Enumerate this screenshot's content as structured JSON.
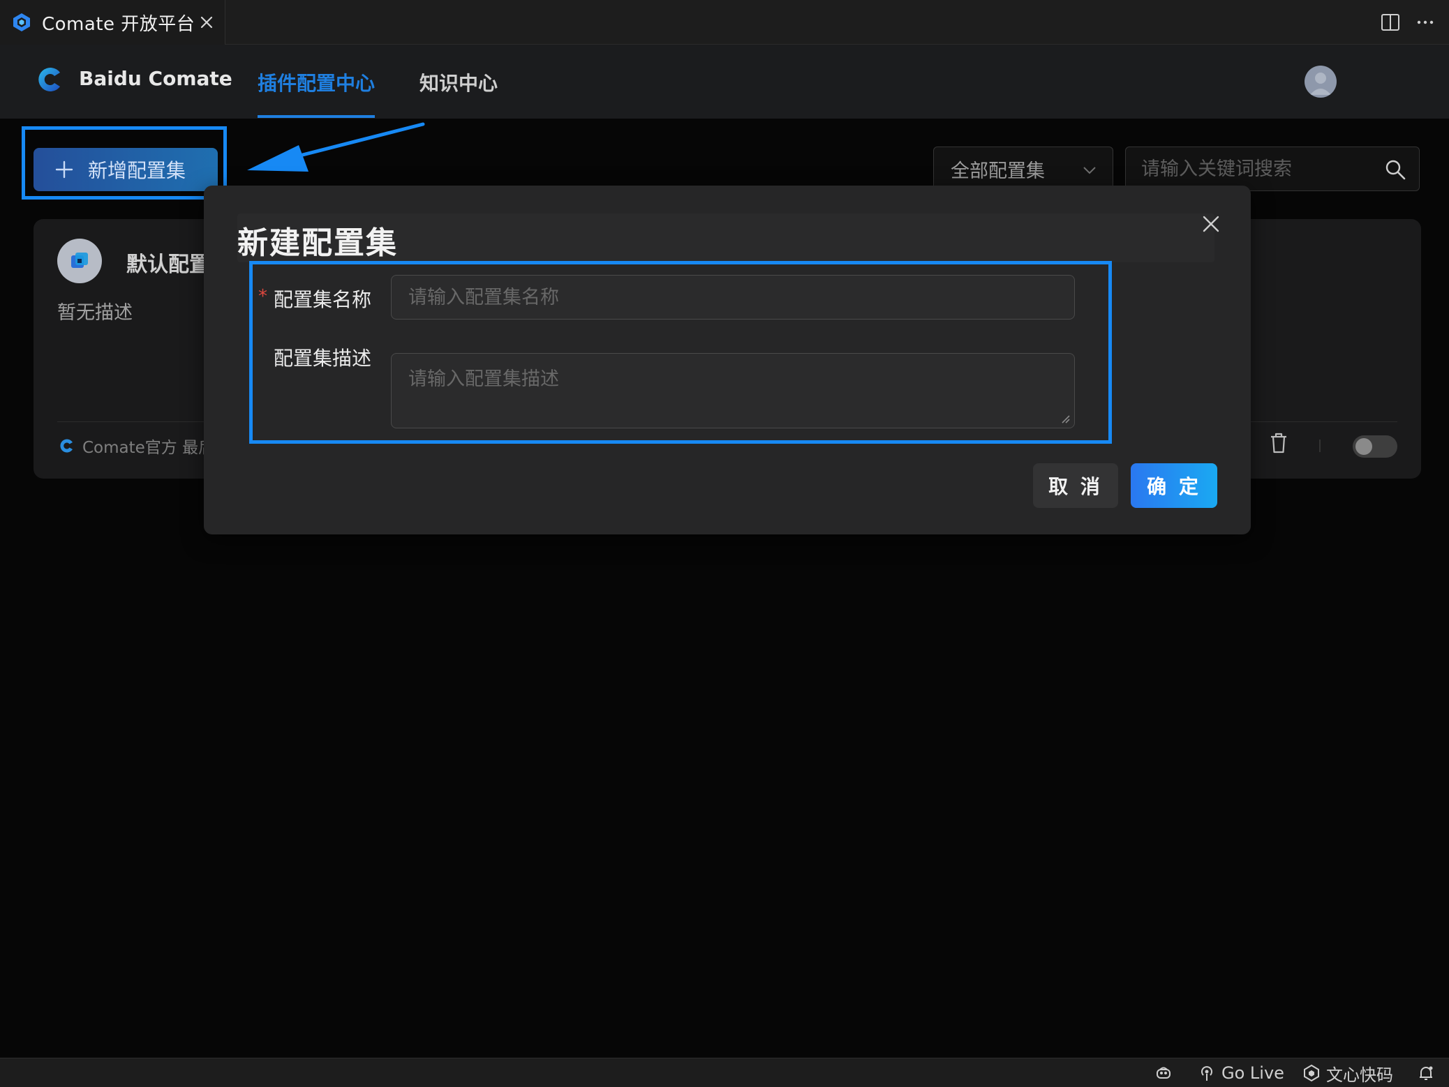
{
  "tab": {
    "title": "Comate 开放平台",
    "icon": "comate-cube-icon"
  },
  "header": {
    "brand": "Baidu Comate",
    "nav": [
      {
        "label": "插件配置中心",
        "active": true
      },
      {
        "label": "知识中心",
        "active": false
      }
    ],
    "accent_color": "#1f7fe0"
  },
  "toolbar": {
    "add_label": "新增配置集",
    "filter_value": "全部配置集",
    "search_placeholder": "请输入关键词搜索"
  },
  "card": {
    "title": "默认配置",
    "description": "暂无描述",
    "footer": "Comate官方 最后"
  },
  "modal": {
    "title": "新建配置集",
    "name_label": "配置集名称",
    "name_required_mark": "*",
    "name_placeholder": "请输入配置集名称",
    "desc_label": "配置集描述",
    "desc_placeholder": "请输入配置集描述",
    "cancel_label": "取 消",
    "ok_label": "确 定"
  },
  "statusbar": {
    "go_live": "Go Live",
    "wenxin": "文心快码"
  },
  "colors": {
    "highlight": "#1789f4",
    "primary": "#2a78f0",
    "required": "#e0483f"
  }
}
